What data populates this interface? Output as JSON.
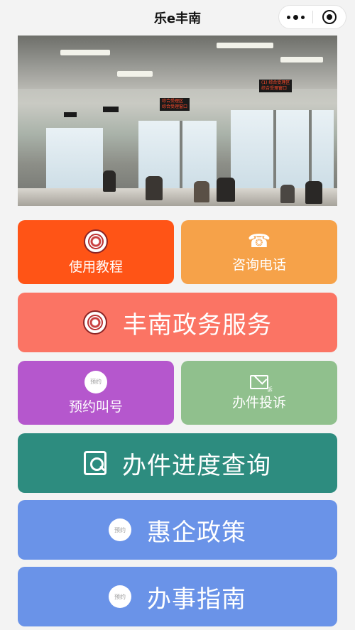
{
  "nav": {
    "title": "乐e丰南"
  },
  "buttons": {
    "tutorial": {
      "label": "使用教程",
      "color": "#ff5416",
      "icon": "emblem-icon"
    },
    "hotline": {
      "label": "咨询电话",
      "color": "#f6a249",
      "icon": "phone-icon"
    },
    "gov_service": {
      "label": "丰南政务服务",
      "color": "#fb7464",
      "icon": "emblem-icon"
    },
    "appointment": {
      "label": "预约叫号",
      "color": "#b557cd",
      "icon": "clock-icon"
    },
    "complaint": {
      "label": "办件投诉",
      "color": "#90c08d",
      "icon": "mail-icon"
    },
    "progress": {
      "label": "办件进度查询",
      "color": "#2d8c7f",
      "icon": "query-icon"
    },
    "policy": {
      "label": "惠企政策",
      "color": "#6a93e8",
      "icon": "clock-icon"
    },
    "guide": {
      "label": "办事指南",
      "color": "#6a93e8",
      "icon": "clock-icon"
    }
  },
  "icons": {
    "clock_text": "预约",
    "complaint_tag": "诉"
  },
  "banner": {
    "sign1": "(1) 综合受理区",
    "sign1b": "综合受理窗口",
    "sign2": "综合受理区",
    "sign2b": "综合受理窗口"
  }
}
